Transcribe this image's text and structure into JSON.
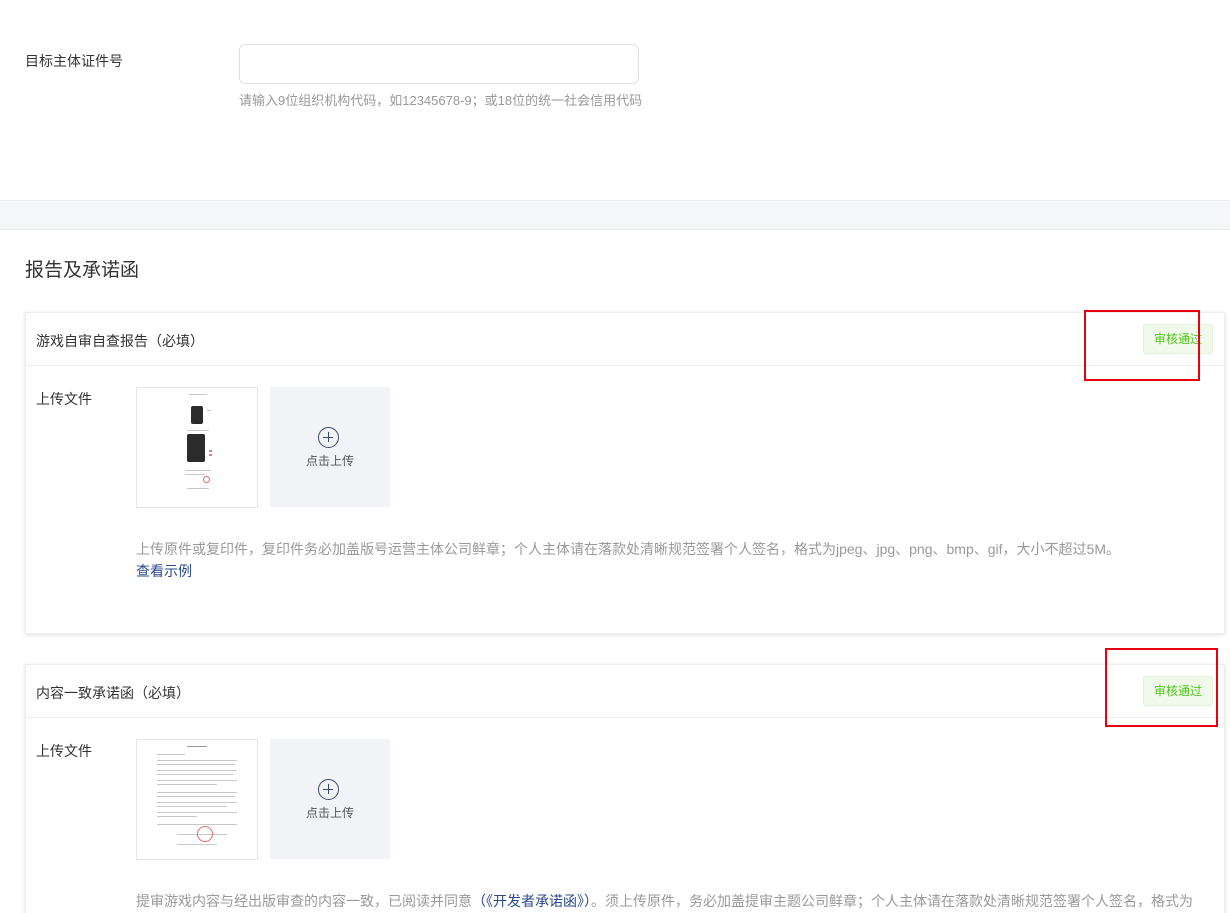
{
  "form": {
    "label": "目标主体证件号",
    "input_value": "",
    "input_placeholder": "",
    "hint": "请输入9位组织机构代码，如12345678-9；或18位的统一社会信用代码"
  },
  "section": {
    "title": "报告及承诺函"
  },
  "cards": [
    {
      "title": "游戏自审自查报告（必填）",
      "status": "审核通过",
      "upload_label": "上传文件",
      "upload_button": "点击上传",
      "desc": "上传原件或复印件，复印件务必加盖版号运营主体公司鲜章；个人主体请在落款处清晰规范签署个人签名，格式为jpeg、jpg、png、bmp、gif，大小不超过5M。",
      "link": "查看示例"
    },
    {
      "title": "内容一致承诺函（必填）",
      "status": "审核通过",
      "upload_label": "上传文件",
      "upload_button": "点击上传",
      "desc_before": "提审游戏内容与经出版审查的内容一致，已阅读并同意",
      "desc_link": "（《开发者承诺函》）",
      "desc_after": "。须上传原件，务必加盖提审主题公司鲜章；个人主体请在落款处清晰规范签署个人签名，格式为"
    }
  ],
  "colors": {
    "status_green": "#52c41a",
    "link_blue": "#2a4a8a",
    "highlight_red": "#e60012"
  }
}
